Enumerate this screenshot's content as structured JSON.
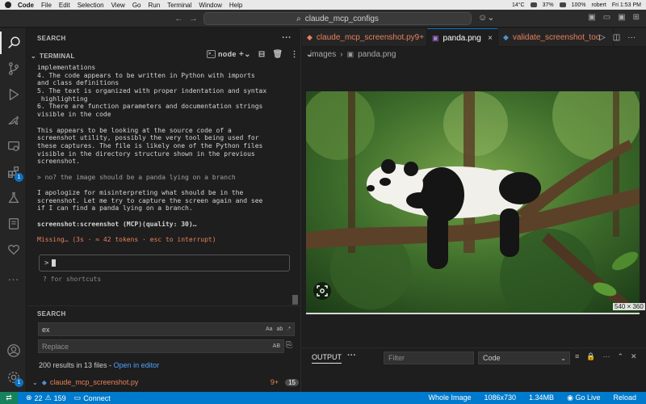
{
  "menubar": {
    "app": "Code",
    "menus": [
      "File",
      "Edit",
      "Selection",
      "View",
      "Go",
      "Run",
      "Terminal",
      "Window",
      "Help"
    ],
    "weather": "14°C",
    "right_text": "37%",
    "battery": "100%",
    "user": "robert",
    "clock": "Fri 1:53 PM"
  },
  "titlebar": {
    "search": "claude_mcp_configs"
  },
  "activity": {
    "extensions_badge": "1",
    "settings_badge": "1"
  },
  "sidebar": {
    "search_header": "SEARCH",
    "terminal_header": "TERMINAL",
    "terminal_shell": "node",
    "terminal_lines": [
      {
        "text": "implementations",
        "cls": ""
      },
      {
        "text": "4. The code appears to be written in Python with imports",
        "cls": ""
      },
      {
        "text": "and class definitions",
        "cls": ""
      },
      {
        "text": "5. The text is organized with proper indentation and syntax",
        "cls": ""
      },
      {
        "text": " highlighting",
        "cls": ""
      },
      {
        "text": "6. There are function parameters and documentation strings",
        "cls": ""
      },
      {
        "text": "visible in the code",
        "cls": ""
      },
      {
        "text": "",
        "cls": ""
      },
      {
        "text": "This appears to be looking at the source code of a",
        "cls": ""
      },
      {
        "text": "screenshot utility, possibly the very tool being used for",
        "cls": ""
      },
      {
        "text": "these captures. The file is likely one of the Python files",
        "cls": ""
      },
      {
        "text": "visible in the directory structure shown in the previous",
        "cls": ""
      },
      {
        "text": "screenshot.",
        "cls": ""
      },
      {
        "text": "",
        "cls": ""
      },
      {
        "text": "> no? the image should be a panda lying on a branch",
        "cls": "user"
      },
      {
        "text": "",
        "cls": ""
      },
      {
        "text": "I apologize for misinterpreting what should be in the",
        "cls": ""
      },
      {
        "text": "screenshot. Let me try to capture the screen again and see",
        "cls": ""
      },
      {
        "text": "if I can find a panda lying on a branch.",
        "cls": ""
      },
      {
        "text": "",
        "cls": ""
      },
      {
        "text": "screenshot:screenshot (MCP)(quality: 30)…",
        "cls": "bold"
      },
      {
        "text": "",
        "cls": ""
      },
      {
        "text": "Missing… (3s · ≈ 42 tokens · esc to interrupt)",
        "cls": "orange"
      }
    ],
    "prompt_symbol": ">",
    "shortcuts_hint": "? for shortcuts",
    "search2_header": "SEARCH",
    "search_value": "ex",
    "search_opts": [
      "Aa",
      "ab",
      ".*"
    ],
    "replace_placeholder": "Replace",
    "replace_opt": "AB",
    "results_text": "200 results in 13 files - ",
    "open_in_editor": "Open in editor",
    "result_file": "claude_mcp_screenshot.py",
    "result_modified": "9+",
    "result_count": "15"
  },
  "editor": {
    "tabs": [
      {
        "label": "claude_mcp_screenshot.py",
        "mark": "9+"
      },
      {
        "label": "panda.png",
        "mark": "×"
      },
      {
        "label": "validate_screenshot_too",
        "mark": ""
      }
    ],
    "breadcrumb": [
      "images",
      "panda.png"
    ],
    "image_dims": "540 × 360"
  },
  "output": {
    "tab": "OUTPUT",
    "filter_placeholder": "Filter",
    "channel": "Code"
  },
  "statusbar": {
    "problems": "22",
    "warnings": "159",
    "connect": "Connect",
    "whole_image": "Whole Image",
    "resolution": "1086x730",
    "filesize": "1.34MB",
    "go_live": "Go Live",
    "reload": "Reload"
  },
  "colors": {
    "accent": "#007acc",
    "modified": "#e7815b",
    "link": "#4fa1ff"
  }
}
